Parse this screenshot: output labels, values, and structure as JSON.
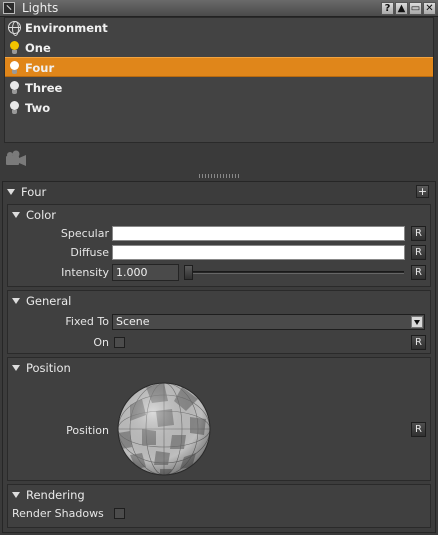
{
  "window": {
    "title": "Lights",
    "buttons": [
      "?",
      "▲",
      "▭",
      "✕"
    ]
  },
  "lights": {
    "items": [
      {
        "label": "Environment",
        "icon": "globe-icon",
        "selected": false
      },
      {
        "label": "One",
        "icon": "bulb-icon",
        "bulb_color": "#f2c400",
        "selected": false
      },
      {
        "label": "Four",
        "icon": "bulb-icon",
        "bulb_color": "#ffffff",
        "selected": true
      },
      {
        "label": "Three",
        "icon": "bulb-icon",
        "bulb_color": "#e8e8e8",
        "selected": false
      },
      {
        "label": "Two",
        "icon": "bulb-icon",
        "bulb_color": "#e8e8e8",
        "selected": false
      }
    ]
  },
  "toolbar": {
    "camera_icon": "camera-light-icon"
  },
  "panel": {
    "title": "Four",
    "add_label": "+",
    "color": {
      "header": "Color",
      "specular_label": "Specular",
      "specular_value": "#ffffff",
      "diffuse_label": "Diffuse",
      "diffuse_value": "#ffffff",
      "intensity_label": "Intensity",
      "intensity_value": "1.000",
      "intensity_fraction": 0.0,
      "reset_label": "R"
    },
    "general": {
      "header": "General",
      "fixed_to_label": "Fixed To",
      "fixed_to_value": "Scene",
      "on_label": "On",
      "on_checked": false,
      "reset_label": "R"
    },
    "position": {
      "header": "Position",
      "position_label": "Position",
      "reset_label": "R"
    },
    "rendering": {
      "header": "Rendering",
      "render_shadows_label": "Render Shadows",
      "render_shadows_checked": false
    }
  },
  "colors": {
    "selection": "#e0861a",
    "panel_bg": "#3c3c3c",
    "list_bg": "#434343"
  }
}
